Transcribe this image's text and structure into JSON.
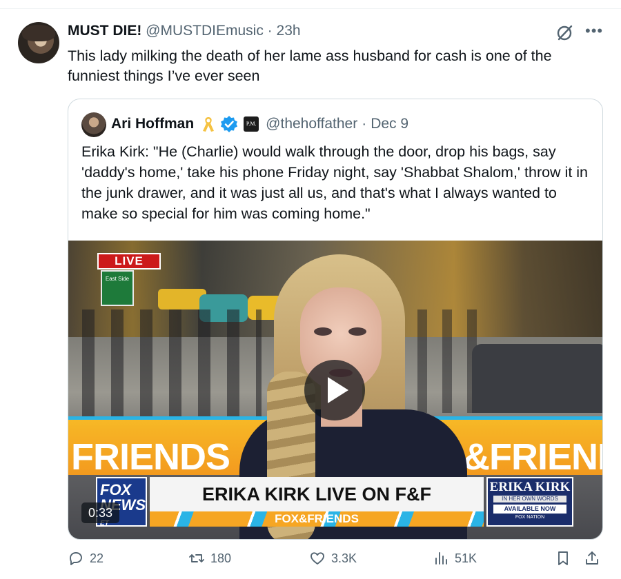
{
  "tweet": {
    "author_name": "MUST DIE!",
    "author_handle": "@MUSTDIEmusic",
    "separator": "·",
    "time": "23h",
    "text": "This lady milking the death of her lame ass husband for cash is one of the funniest things I’ve ever seen",
    "icons": {
      "grok": "grok-icon",
      "more": "more-icon"
    }
  },
  "quoted_tweet": {
    "author_name": "Ari Hoffman",
    "author_handle": "@thehoffather",
    "separator": "·",
    "date": "Dec 9",
    "affiliate_badge_text": "P.M.",
    "text": "Erika Kirk: \"He (Charlie) would walk through the door, drop his bags, say 'daddy's home,' take his phone Friday night, say 'Shabbat Shalom,' throw it in the junk drawer, and it was just all us, and that's what I always wanted to make so special for him was coming home.\"",
    "video": {
      "duration": "0:33",
      "live_badge": "LIVE",
      "street_sign": "East Side",
      "banner_left": "FRIENDS",
      "banner_right": "&FRIEND",
      "network_logo": "FOX NEWS",
      "network_sub": "ET",
      "headline": "ERIKA KIRK LIVE ON F&F",
      "show_strip": "FOX&FRIENDS",
      "side_title": "ERIKA KIRK",
      "side_sub": "IN HER OWN WORDS",
      "side_available": "AVAILABLE NOW",
      "side_brand": "FOX NATION"
    }
  },
  "actions": {
    "replies": "22",
    "retweets": "180",
    "likes": "3.3K",
    "views": "51K"
  },
  "colors": {
    "text_primary": "#0f1419",
    "text_secondary": "#536471",
    "border": "#cfd9de",
    "verified": "#1d9bf0",
    "ribbon": "#f5c242"
  }
}
